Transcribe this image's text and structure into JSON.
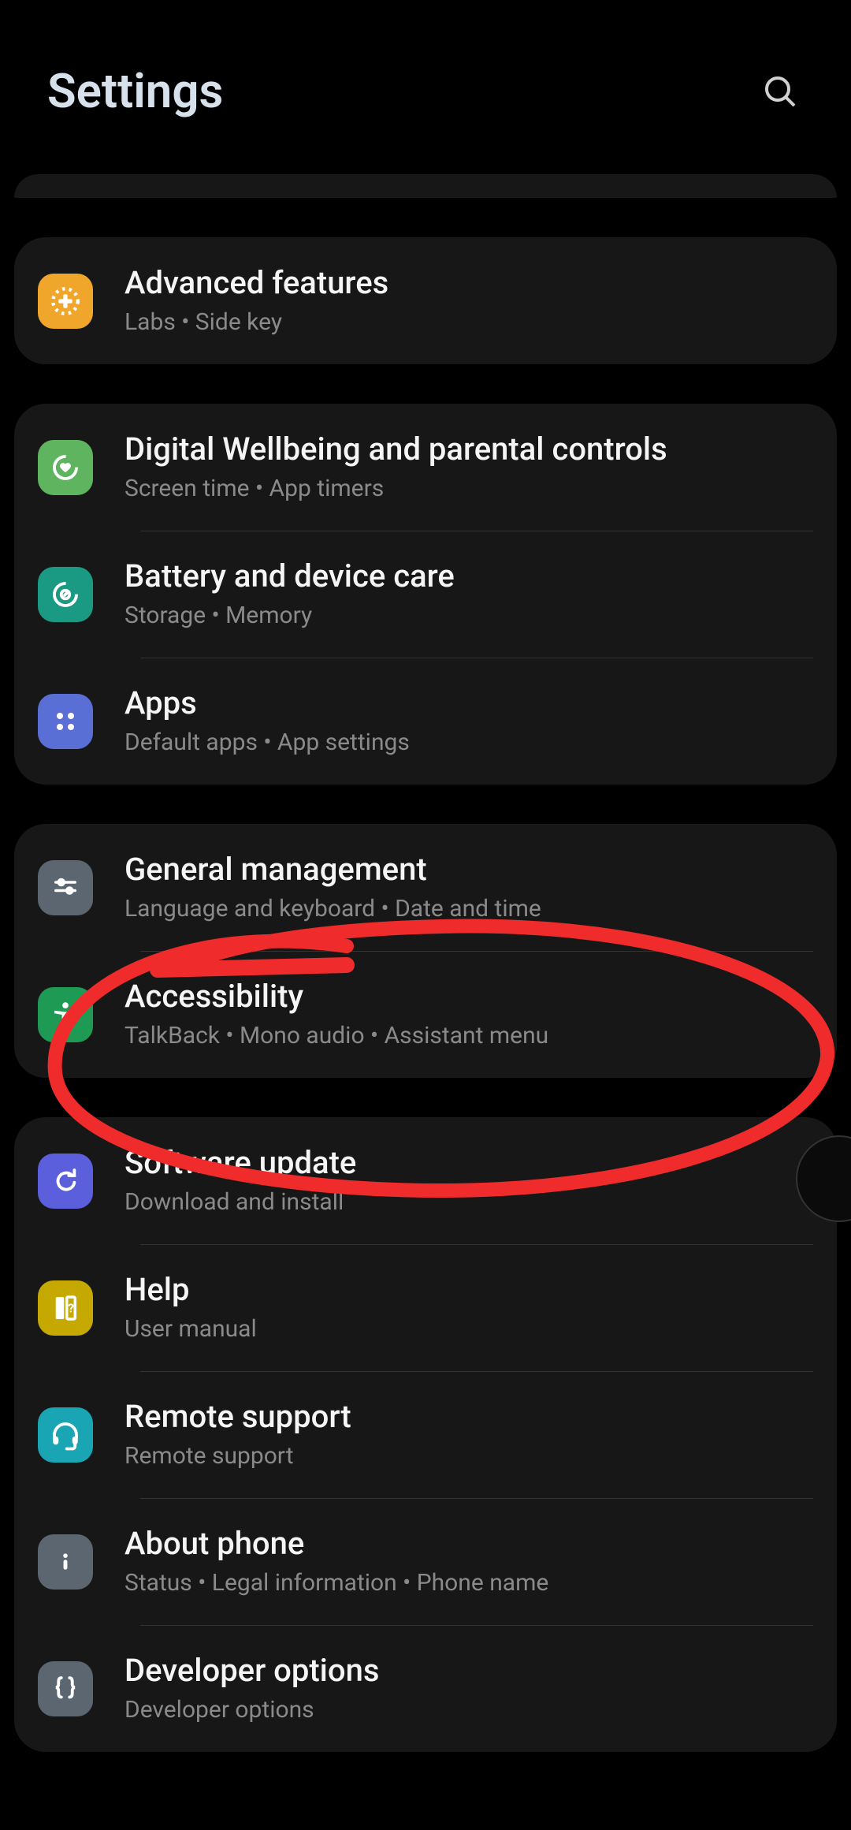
{
  "header": {
    "title": "Settings"
  },
  "groups": [
    {
      "rows": [
        {
          "key": "advanced",
          "title": "Advanced features",
          "sub": "Labs  •  Side key",
          "iconBg": "#f0a52b"
        }
      ]
    },
    {
      "rows": [
        {
          "key": "wellbeing",
          "title": "Digital Wellbeing and parental controls",
          "sub": "Screen time  •  App timers",
          "iconBg": "#5fb55f"
        },
        {
          "key": "battery",
          "title": "Battery and device care",
          "sub": "Storage  •  Memory",
          "iconBg": "#1a9a82"
        },
        {
          "key": "apps",
          "title": "Apps",
          "sub": "Default apps  •  App settings",
          "iconBg": "#5a6fd6"
        }
      ]
    },
    {
      "rows": [
        {
          "key": "general",
          "title": "General management",
          "sub": "Language and keyboard  •  Date and time",
          "iconBg": "#5c6670"
        },
        {
          "key": "accessibility",
          "title": "Accessibility",
          "sub": "TalkBack  •  Mono audio  •  Assistant menu",
          "iconBg": "#1f9a54"
        }
      ]
    },
    {
      "rows": [
        {
          "key": "software",
          "title": "Software update",
          "sub": "Download and install",
          "iconBg": "#5c5fdc"
        },
        {
          "key": "help",
          "title": "Help",
          "sub": "User manual",
          "iconBg": "#c6a900"
        },
        {
          "key": "remote",
          "title": "Remote support",
          "sub": "Remote support",
          "iconBg": "#1aa5b5"
        },
        {
          "key": "about",
          "title": "About phone",
          "sub": "Status  •  Legal information  •  Phone name",
          "iconBg": "#5c6670"
        },
        {
          "key": "dev",
          "title": "Developer options",
          "sub": "Developer options",
          "iconBg": "#5c6670"
        }
      ]
    }
  ],
  "annotation": {
    "color": "#ef2b2b"
  }
}
